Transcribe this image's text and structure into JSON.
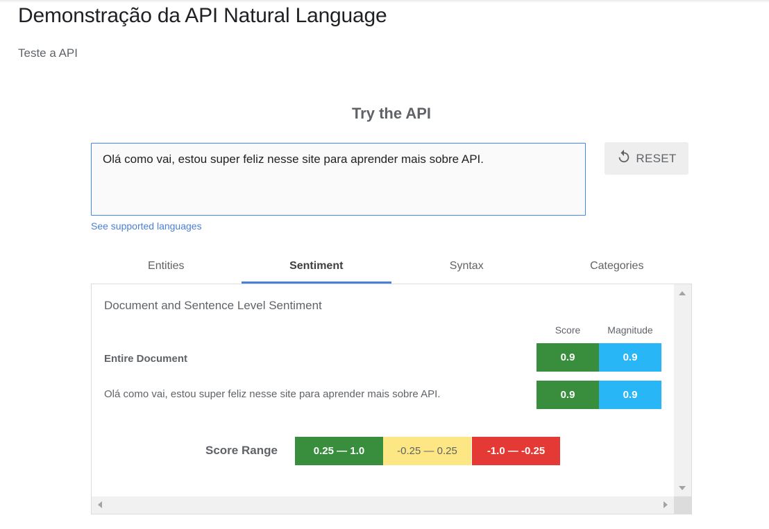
{
  "page": {
    "title": "Demonstração da API Natural Language",
    "subtitle": "Teste a API"
  },
  "demo": {
    "section_title": "Try the API",
    "input_text": "Olá como vai, estou super feliz nesse site para aprender mais sobre API.",
    "reset_label": "RESET",
    "languages_link": "See supported languages"
  },
  "tabs": [
    {
      "label": "Entities",
      "active": false
    },
    {
      "label": "Sentiment",
      "active": true
    },
    {
      "label": "Syntax",
      "active": false
    },
    {
      "label": "Categories",
      "active": false
    }
  ],
  "sentiment": {
    "heading": "Document and Sentence Level Sentiment",
    "columns": {
      "score": "Score",
      "magnitude": "Magnitude"
    },
    "rows": [
      {
        "label": "Entire Document",
        "score": "0.9",
        "magnitude": "0.9"
      },
      {
        "label": "Olá como vai, estou super feliz nesse site para aprender mais sobre API.",
        "score": "0.9",
        "magnitude": "0.9"
      }
    ],
    "score_range": {
      "label": "Score Range",
      "positive": "0.25 — 1.0",
      "neutral": "-0.25 — 0.25",
      "negative": "-1.0 — -0.25"
    }
  },
  "colors": {
    "accent": "#4a7fd6",
    "positive": "#388e3c",
    "magnitude": "#29b6f6",
    "neutral": "#fde684",
    "negative": "#e53935"
  },
  "icons": {
    "reset": "refresh-icon"
  }
}
